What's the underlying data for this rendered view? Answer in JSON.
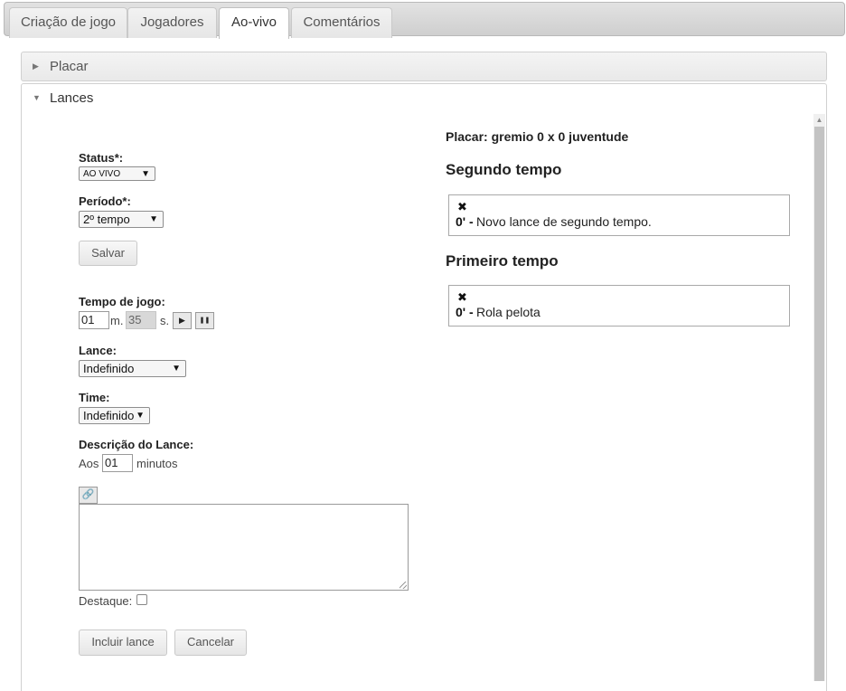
{
  "tabs": [
    {
      "label": "Criação de jogo",
      "active": false
    },
    {
      "label": "Jogadores",
      "active": false
    },
    {
      "label": "Ao-vivo",
      "active": true
    },
    {
      "label": "Comentários",
      "active": false
    }
  ],
  "accordion": {
    "placar": {
      "label": "Placar",
      "expanded": false
    },
    "lances": {
      "label": "Lances",
      "expanded": true
    }
  },
  "form": {
    "status": {
      "label": "Status*:",
      "value": "AO VIVO"
    },
    "periodo": {
      "label": "Período*:",
      "value": "2º tempo"
    },
    "salvar_label": "Salvar",
    "tempo_de_jogo": {
      "label": "Tempo de jogo:",
      "minutes": "01",
      "minutes_suffix": "m.",
      "seconds": "35",
      "seconds_suffix": "s.",
      "play_icon": "▶",
      "pause_icon": "❚❚"
    },
    "lance": {
      "label": "Lance:",
      "value": "Indefinido"
    },
    "time": {
      "label": "Time:",
      "value": "Indefinido"
    },
    "descricao": {
      "label": "Descrição do Lance:",
      "prefix": "Aos",
      "minutes": "01",
      "suffix": "minutos"
    },
    "editor_link_icon": "link-icon",
    "destaque_label": "Destaque:",
    "destaque_checked": false,
    "incluir_label": "Incluir lance",
    "cancelar_label": "Cancelar"
  },
  "scoreboard": {
    "text": "Placar: gremio 0 x 0 juventude"
  },
  "sections": [
    {
      "title": "Segundo tempo",
      "events": [
        {
          "time": "0' -",
          "description": "Novo lance de segundo tempo."
        }
      ]
    },
    {
      "title": "Primeiro tempo",
      "events": [
        {
          "time": "0' -",
          "description": "Rola pelota"
        }
      ]
    }
  ],
  "icons": {
    "delete": "✖",
    "collapsed": "▶",
    "expanded": "▼",
    "caret": "▼"
  }
}
